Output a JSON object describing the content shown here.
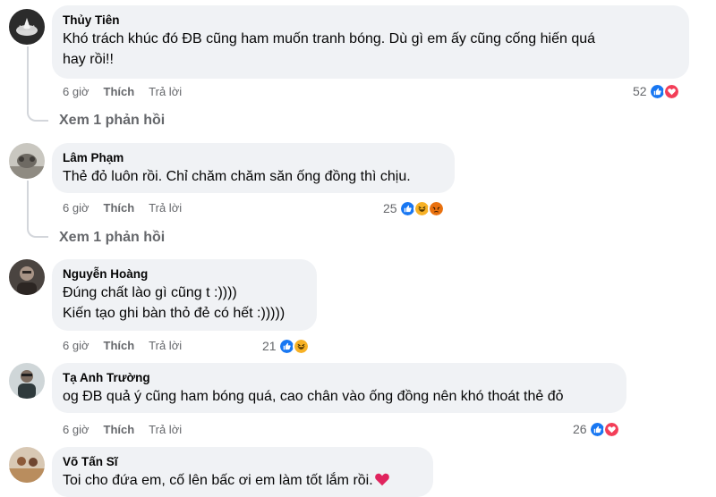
{
  "comments": [
    {
      "author": "Thủy Tiên",
      "lines": [
        "Khó trách khúc đó ĐB cũng ham muốn tranh bóng. Dù gì em ấy cũng cống hiến quá",
        "hay rồi!!"
      ],
      "time": "6 giờ",
      "like_label": "Thích",
      "reply_label": "Trả lời",
      "reaction_count": "52",
      "reactions": [
        "like",
        "love"
      ],
      "view_replies": "Xem 1 phản hồi"
    },
    {
      "author": "Lâm Phạm",
      "lines": [
        "Thẻ đỏ luôn rồi. Chỉ chăm chăm săn ống đồng thì chịu."
      ],
      "time": "6 giờ",
      "like_label": "Thích",
      "reply_label": "Trả lời",
      "reaction_count": "25",
      "reactions": [
        "like",
        "haha",
        "angry"
      ],
      "view_replies": "Xem 1 phản hồi"
    },
    {
      "author": "Nguyễn Hoàng",
      "lines": [
        "Đúng chất lào gì cũng t :))))",
        "Kiến tạo ghi bàn thỏ đẻ có hết :)))))"
      ],
      "time": "6 giờ",
      "like_label": "Thích",
      "reply_label": "Trả lời",
      "reaction_count": "21",
      "reactions": [
        "like",
        "haha"
      ]
    },
    {
      "author": "Tạ Anh Trường",
      "lines": [
        "og ĐB quả ý cũng ham bóng quá, cao chân vào ống đồng nên khó thoát thẻ đỏ"
      ],
      "time": "6 giờ",
      "like_label": "Thích",
      "reply_label": "Trả lời",
      "reaction_count": "26",
      "reactions": [
        "like",
        "love"
      ]
    },
    {
      "author": "Võ Tấn Sĩ",
      "lines": [
        "Toi cho đứa em, cố lên bấc ơi em làm tốt lắm rồi."
      ]
    }
  ],
  "colors": {
    "bubble": "#f0f2f5",
    "meta": "#65676b",
    "like": "#1877f2",
    "love": "#f33e58",
    "haha": "#f7b125",
    "angry": "#e9710f"
  },
  "icons": [
    "like-reaction-icon",
    "love-reaction-icon",
    "haha-reaction-icon",
    "angry-reaction-icon",
    "heart-emoji-icon"
  ]
}
